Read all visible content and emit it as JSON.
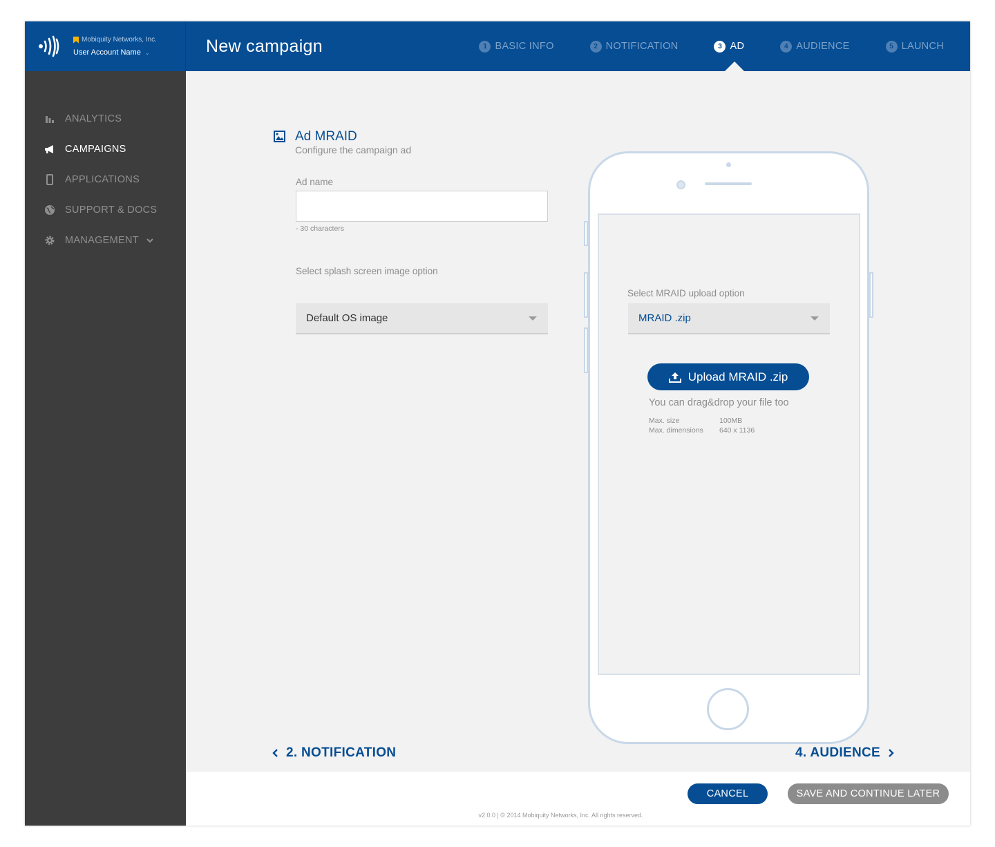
{
  "brand": {
    "org_name": "Mobiquity Networks, Inc.",
    "user_name": "User Account Name"
  },
  "header": {
    "title": "New campaign",
    "steps": [
      {
        "num": "1",
        "label": "BASIC INFO"
      },
      {
        "num": "2",
        "label": "NOTIFICATION"
      },
      {
        "num": "3",
        "label": "AD"
      },
      {
        "num": "4",
        "label": "AUDIENCE"
      },
      {
        "num": "5",
        "label": "LAUNCH"
      }
    ],
    "active_step": "AD"
  },
  "sidebar": {
    "items": [
      {
        "label": "ANALYTICS",
        "icon": "bar-chart-icon"
      },
      {
        "label": "CAMPAIGNS",
        "icon": "megaphone-icon",
        "active": true
      },
      {
        "label": "APPLICATIONS",
        "icon": "mobile-icon"
      },
      {
        "label": "SUPPORT & DOCS",
        "icon": "globe-icon"
      },
      {
        "label": "MANAGEMENT",
        "icon": "gear-icon"
      }
    ]
  },
  "form": {
    "section_title": "Ad MRAID",
    "section_subtitle": "Configure the campaign ad",
    "ad_name_label": "Ad name",
    "ad_name_value": "",
    "ad_name_hint": "- 30 characters",
    "splash_label": "Select splash screen image option",
    "splash_value": "Default OS image"
  },
  "preview": {
    "upload_option_label": "Select MRAID upload option",
    "upload_option_value": "MRAID .zip",
    "upload_button": "Upload MRAID .zip",
    "drag_text": "You can drag&drop your file too",
    "specs": [
      {
        "key": "Max. size",
        "value": "100MB"
      },
      {
        "key": "Max. dimensions",
        "value": "640 x 1136"
      }
    ]
  },
  "pager": {
    "prev": "2. NOTIFICATION",
    "next": "4. AUDIENCE"
  },
  "footer": {
    "cancel": "CANCEL",
    "save": "SAVE AND CONTINUE LATER",
    "copyright": "v2.0.0  |  © 2014 Mobiquity Networks, Inc. All rights reserved."
  },
  "colors": {
    "primary": "#064d93",
    "sidebar": "#3d3d3d",
    "accent_flag": "#f5b400"
  }
}
